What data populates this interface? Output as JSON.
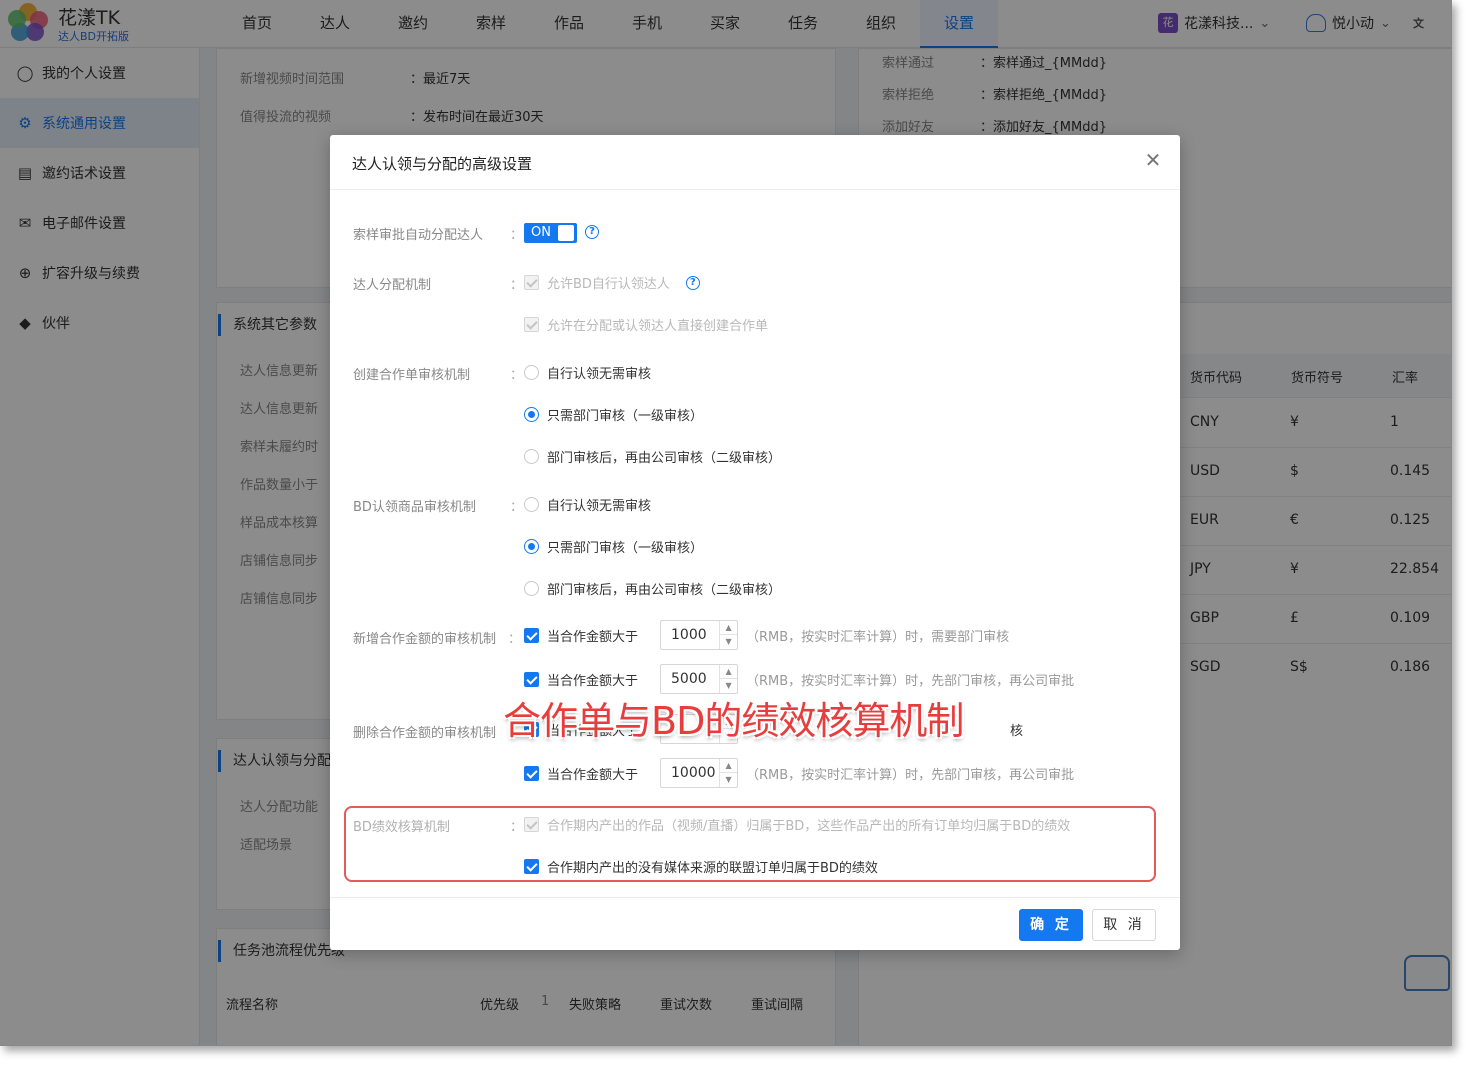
{
  "brand": {
    "name": "花漾TK",
    "subtitle": "达人BD开拓版"
  },
  "nav": [
    {
      "label": "首页"
    },
    {
      "label": "达人"
    },
    {
      "label": "邀约"
    },
    {
      "label": "索样"
    },
    {
      "label": "作品"
    },
    {
      "label": "手机"
    },
    {
      "label": "买家"
    },
    {
      "label": "任务"
    },
    {
      "label": "组织"
    },
    {
      "label": "设置",
      "active": true
    }
  ],
  "company": {
    "badge": "花",
    "name": "花漾科技..."
  },
  "user": {
    "name": "悦小动"
  },
  "sidebar": [
    {
      "label": "我的个人设置",
      "icon": "user-icon"
    },
    {
      "label": "系统通用设置",
      "icon": "gear-icon",
      "active": true
    },
    {
      "label": "邀约话术设置",
      "icon": "document-icon"
    },
    {
      "label": "电子邮件设置",
      "icon": "mail-icon"
    },
    {
      "label": "扩容升级与续费",
      "icon": "upgrade-icon"
    },
    {
      "label": "伙伴",
      "icon": "partner-icon"
    }
  ],
  "background": {
    "top_left": [
      {
        "label": "新增视频时间范围",
        "value": "最近7天"
      },
      {
        "label": "值得投流的视频",
        "value": "发布时间在最近30天"
      }
    ],
    "top_right": [
      {
        "label": "索样通过",
        "value": "索样通过_{MMdd}"
      },
      {
        "label": "索样拒绝",
        "value": "索样拒绝_{MMdd}"
      },
      {
        "label": "添加好友",
        "value": "添加好友_{MMdd}"
      }
    ],
    "system_params": {
      "title": "系统其它参数",
      "rows": [
        "达人信息更新",
        "达人信息更新",
        "索样未履约时",
        "作品数量小于",
        "样品成本核算",
        "店铺信息同步",
        "店铺信息同步"
      ]
    },
    "claim_section": {
      "title": "达人认领与分配",
      "rows": [
        "达人分配功能",
        "适配场景"
      ]
    },
    "task_section": {
      "title": "任务池流程优先级",
      "columns": [
        "流程名称",
        "优先级",
        "1",
        "失败策略",
        "重试次数",
        "重试间隔"
      ]
    },
    "currency": {
      "columns": [
        "货币代码",
        "货币符号",
        "汇率"
      ],
      "rows": [
        [
          "CNY",
          "¥",
          "1"
        ],
        [
          "USD",
          "$",
          "0.145"
        ],
        [
          "EUR",
          "€",
          "0.125"
        ],
        [
          "JPY",
          "¥",
          "22.854"
        ],
        [
          "GBP",
          "£",
          "0.109"
        ],
        [
          "SGD",
          "S$",
          "0.186"
        ]
      ]
    }
  },
  "dialog": {
    "title": "达人认领与分配的高级设置",
    "auto_assign": {
      "label": "索样审批自动分配达人",
      "toggle_text": "ON",
      "enabled": true
    },
    "assign_mechanism": {
      "label": "达人分配机制",
      "options": [
        "允许BD自行认领达人",
        "允许在分配或认领达人直接创建合作单"
      ]
    },
    "create_order_review": {
      "label": "创建合作单审核机制",
      "options": [
        "自行认领无需审核",
        "只需部门审核（一级审核）",
        "部门审核后，再由公司审核（二级审核）"
      ],
      "selected": 1
    },
    "bd_claim_review": {
      "label": "BD认领商品审核机制",
      "options": [
        "自行认领无需审核",
        "只需部门审核（一级审核）",
        "部门审核后，再由公司审核（二级审核）"
      ],
      "selected": 1
    },
    "add_amount_review": {
      "label": "新增合作金额的审核机制",
      "rows": [
        {
          "prefix": "当合作金额大于",
          "amount": "1000",
          "suffix": "（RMB，按实时汇率计算）时，需要部门审核"
        },
        {
          "prefix": "当合作金额大于",
          "amount": "5000",
          "suffix": "（RMB，按实时汇率计算）时，先部门审核，再公司审批"
        }
      ]
    },
    "delete_amount_review": {
      "label": "删除合作金额的审核机制",
      "rows": [
        {
          "prefix": "当合作金额大于",
          "amount": "",
          "suffix": "核"
        },
        {
          "prefix": "当合作金额大于",
          "amount": "10000",
          "suffix": "（RMB，按实时汇率计算）时，先部门审核，再公司审批"
        }
      ]
    },
    "bd_performance": {
      "label": "BD绩效核算机制",
      "options": [
        "合作期内产出的作品（视频/直播）归属于BD，这些作品产出的所有订单均归属于BD的绩效",
        "合作期内产出的没有媒体来源的联盟订单归属于BD的绩效"
      ]
    },
    "ok_label": "确 定",
    "cancel_label": "取 消"
  },
  "overlay_caption": "合作单与BD的绩效核算机制",
  "colors": {
    "accent": "#1478f0",
    "highlight": "#e35a5a",
    "caption": "#e83d3d"
  }
}
